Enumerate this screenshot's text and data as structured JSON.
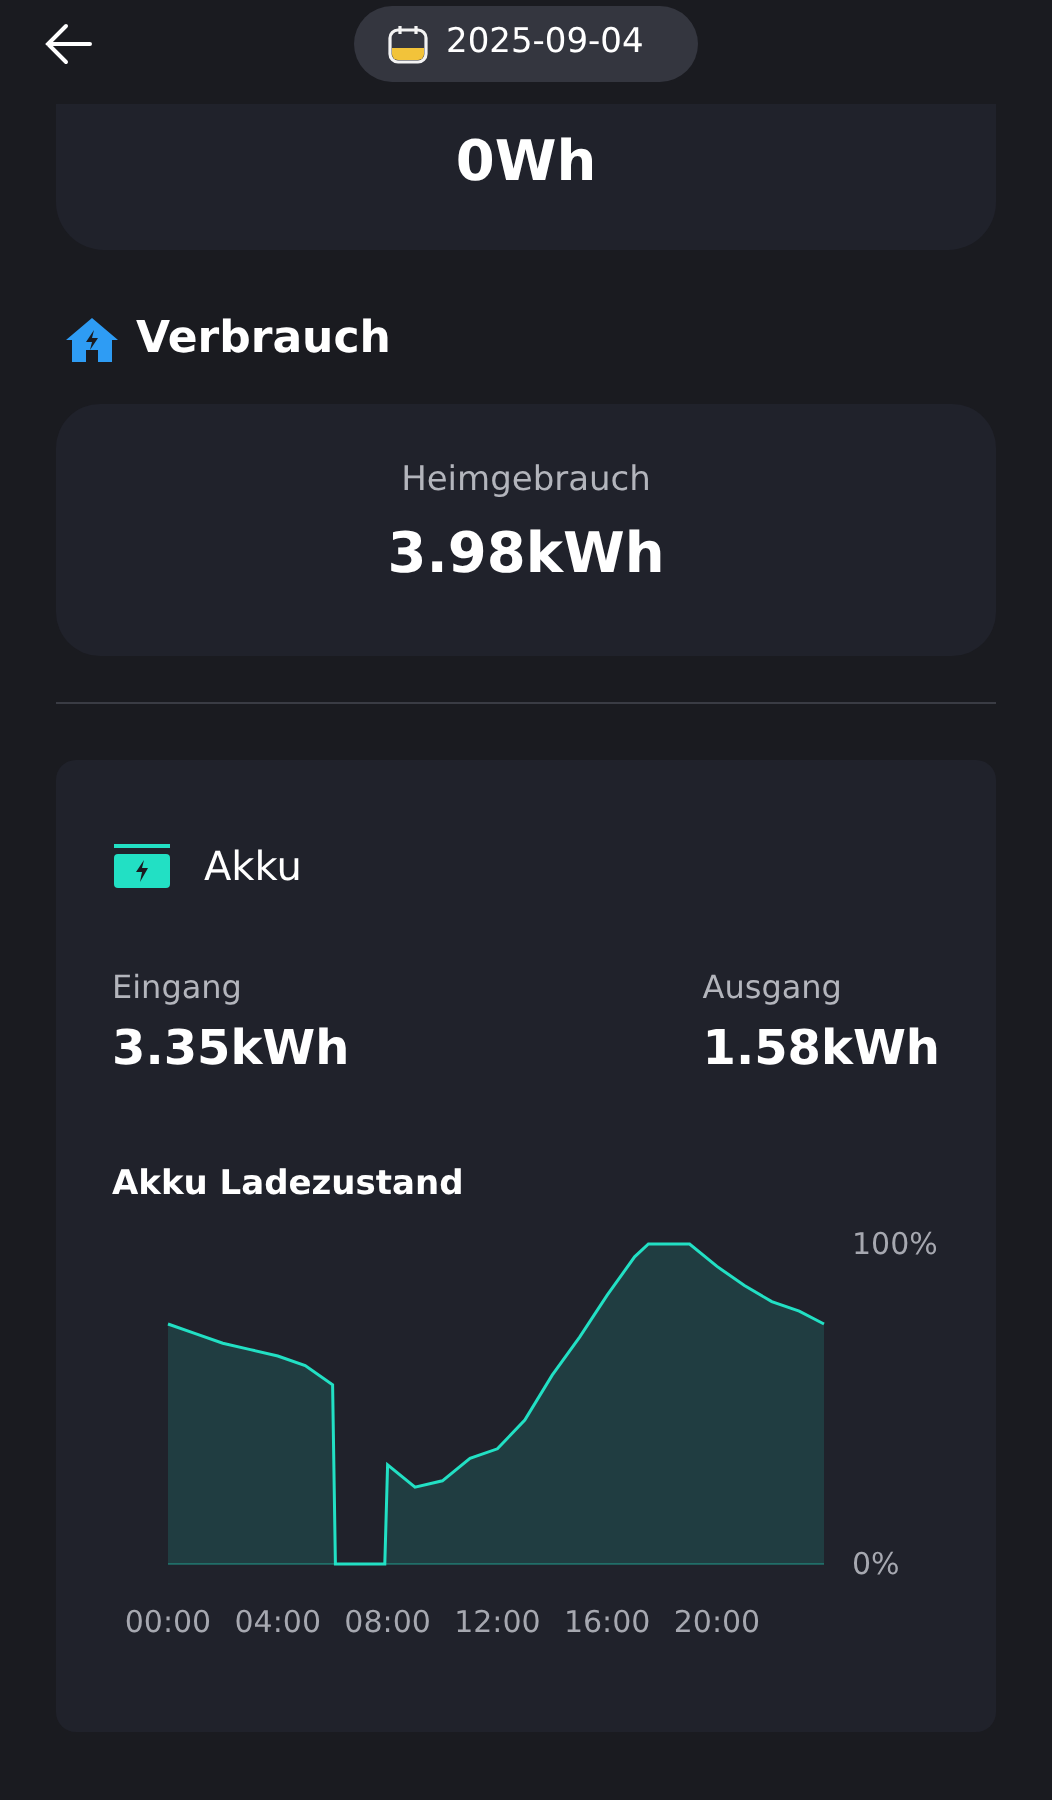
{
  "header": {
    "date": "2025-09-04"
  },
  "top_card": {
    "value": "0Wh"
  },
  "consumption": {
    "title": "Verbrauch",
    "label": "Heimgebrauch",
    "value": "3.98kWh"
  },
  "battery": {
    "title": "Akku",
    "stats": [
      {
        "label": "Eingang",
        "value": "3.35kWh"
      },
      {
        "label": "Ausgang",
        "value": "1.58kWh"
      }
    ],
    "chart_title": "Akku Ladezustand",
    "chart_data": {
      "type": "area",
      "x": [
        0,
        1,
        2,
        3,
        4,
        5,
        6,
        6.1,
        7.9,
        8,
        9,
        10,
        11,
        12,
        13,
        14,
        15,
        16,
        17,
        17.5,
        19,
        20,
        21,
        22,
        23,
        23.9
      ],
      "series": [
        {
          "color": "#22e0c4",
          "values": [
            75,
            72,
            69,
            67,
            65,
            62,
            56,
            0,
            0,
            31,
            24,
            26,
            33,
            36,
            45,
            59,
            71,
            84,
            96,
            100,
            100,
            93,
            87,
            82,
            79,
            75
          ]
        }
      ],
      "xlim": [
        0,
        23.9
      ],
      "ylim": [
        0,
        100
      ],
      "xticks": [
        {
          "value": 0,
          "label": "00:00"
        },
        {
          "value": 4,
          "label": "04:00"
        },
        {
          "value": 8,
          "label": "08:00"
        },
        {
          "value": 12,
          "label": "12:00"
        },
        {
          "value": 16,
          "label": "16:00"
        },
        {
          "value": 20,
          "label": "20:00"
        }
      ],
      "yticks": [
        {
          "value": 0,
          "label": "0%"
        },
        {
          "value": 100,
          "label": "100%"
        }
      ]
    }
  }
}
